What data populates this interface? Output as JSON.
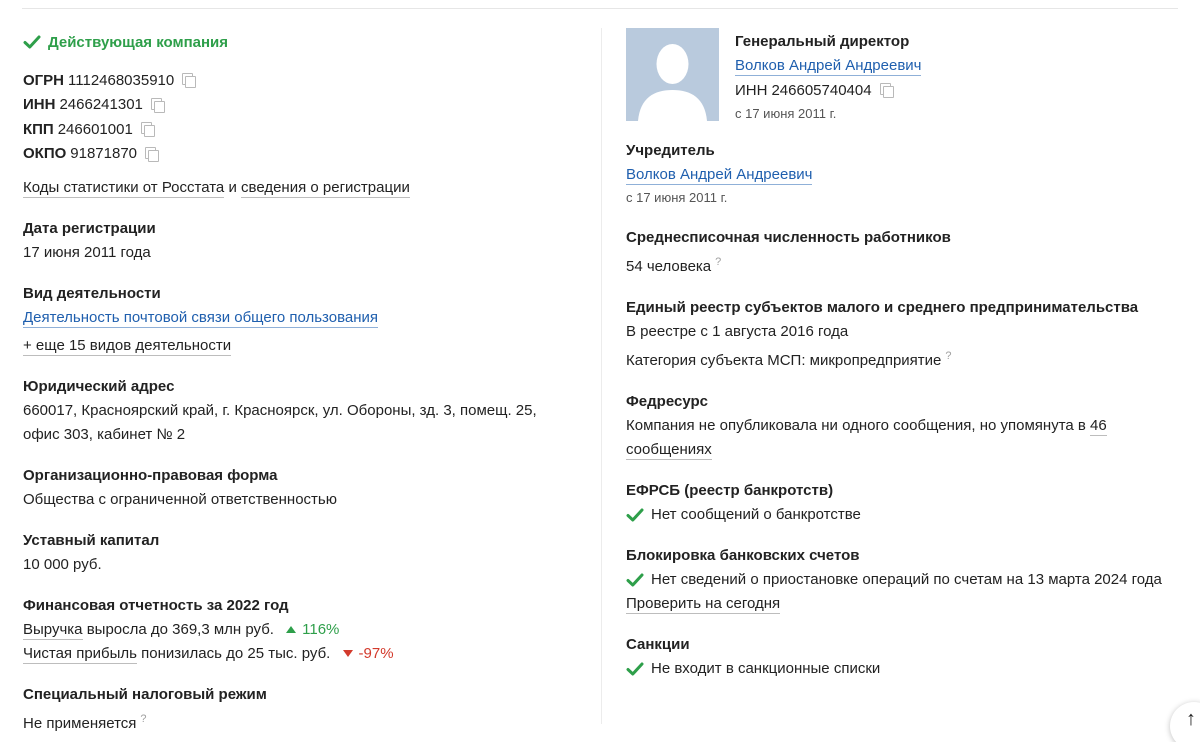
{
  "status": {
    "text": "Действующая компания"
  },
  "codes": [
    {
      "label": "ОГРН",
      "value": "1112468035910"
    },
    {
      "label": "ИНН",
      "value": "2466241301"
    },
    {
      "label": "КПП",
      "value": "246601001"
    },
    {
      "label": "ОКПО",
      "value": "91871870"
    }
  ],
  "rosstat": {
    "link": "Коды статистики от Росстата",
    "and": "и",
    "link2": "сведения о регистрации"
  },
  "registration": {
    "label": "Дата регистрации",
    "value": "17 июня 2011 года"
  },
  "activity": {
    "label": "Вид деятельности",
    "main": "Деятельность почтовой связи общего пользования",
    "more": "+ еще 15 видов деятельности"
  },
  "address": {
    "label": "Юридический адрес",
    "line1": "660017, Красноярский край, г. Красноярск, ул. Обороны, зд. 3, помещ. 25,",
    "line2": "офис 303, кабинет № 2"
  },
  "legal_form": {
    "label": "Организационно-правовая форма",
    "value": "Общества с ограниченной ответственностью"
  },
  "capital": {
    "label": "Уставный капитал",
    "value": "10 000 руб."
  },
  "finance": {
    "label": "Финансовая отчетность за 2022 год",
    "revenue_link": "Выручка",
    "revenue_text": "выросла до 369,3 млн руб.",
    "revenue_change": "116%",
    "profit_link": "Чистая прибыль",
    "profit_text": "понизилась до 25 тыс. руб.",
    "profit_change": "-97%"
  },
  "tax": {
    "label": "Специальный налоговый режим",
    "value": "Не применяется",
    "hint": "?"
  },
  "director": {
    "role": "Генеральный директор",
    "name": "Волков Андрей Андреевич",
    "inn_label": "ИНН",
    "inn": "246605740404",
    "since": "с 17 июня 2011 г."
  },
  "founder": {
    "label": "Учредитель",
    "name": "Волков Андрей Андреевич",
    "since": "с 17 июня 2011 г."
  },
  "employees": {
    "label": "Среднесписочная численность работников",
    "value": "54 человека",
    "hint": "?"
  },
  "msp": {
    "label": "Единый реестр субъектов малого и среднего предпринимательства",
    "line1": "В реестре с 1 августа 2016 года",
    "line2": "Категория субъекта МСП: микропредприятие",
    "hint": "?"
  },
  "fedresurs": {
    "label": "Федресурс",
    "text": "Компания не опубликовала ни одного сообщения, но упомянута в",
    "link": "46 сообщениях"
  },
  "efrsb": {
    "label": "ЕФРСБ (реестр банкротств)",
    "value": "Нет сообщений о банкротстве"
  },
  "blocking": {
    "label": "Блокировка банковских счетов",
    "value": "Нет сведений о приостановке операций по счетам на 13 марта 2024 года",
    "link": "Проверить на сегодня"
  },
  "sanctions": {
    "label": "Санкции",
    "value": "Не входит в санкционные списки"
  },
  "scroll_up": {
    "icon": "↑"
  },
  "colors": {
    "green": "#2e9f4a",
    "red": "#d33a2c",
    "link": "#1f5fae"
  }
}
